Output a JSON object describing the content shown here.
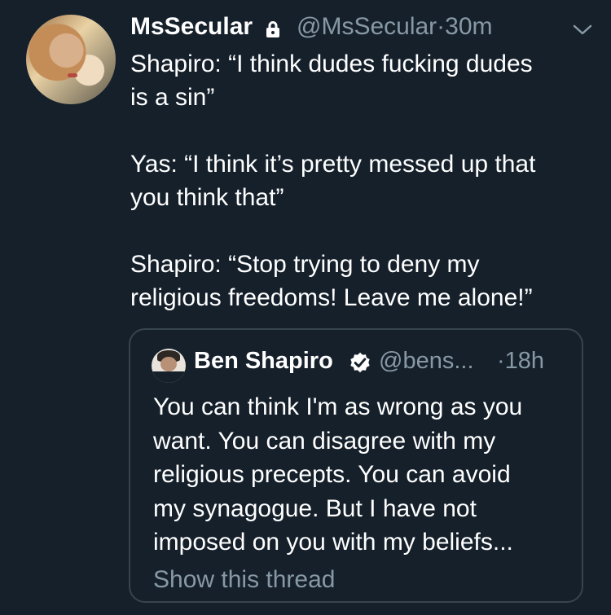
{
  "tweet": {
    "author_name": "MsSecular",
    "author_handle": "@MsSecular",
    "separator": "·",
    "time": "30m",
    "text": "Shapiro: “I think dudes fucking dudes\nis a sin”\n\nYas: “I think it’s pretty messed up that\nyou think that”\n\nShapiro: “Stop trying to deny my\nreligious freedoms! Leave me alone!”",
    "icons": {
      "lock": "lock-icon",
      "menu": "chevron-down-icon",
      "avatar": "profile-photo"
    }
  },
  "quoted_tweet": {
    "author_name": "Ben Shapiro",
    "author_handle": "@bens...",
    "separator": "·",
    "time": "18h",
    "text": "You can think I'm as wrong as you\nwant. You can disagree with my\nreligious precepts. You can avoid\nmy synagogue. But I have not\nimposed on you with my beliefs...",
    "show_thread": "Show this thread",
    "icons": {
      "verified": "verified-badge-icon"
    }
  },
  "colors": {
    "background": "#15202b",
    "text": "#ffffff",
    "muted": "#8899a6",
    "border": "#38444d"
  }
}
